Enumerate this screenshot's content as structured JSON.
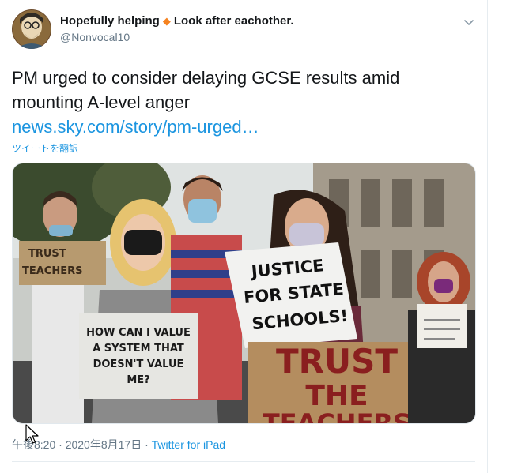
{
  "author": {
    "display_name": "Hopefully helping",
    "badge": "◆",
    "display_name_suffix": "Look after eachother.",
    "handle": "@Nonvocal10",
    "avatar_icon": "illustrated-portrait-avatar"
  },
  "tweet": {
    "text": "PM urged to consider delaying GCSE results amid mounting A-level anger",
    "link_text": "news.sky.com/story/pm-urged…",
    "translate_label": "ツイートを翻訳"
  },
  "media": {
    "signs": {
      "trust_teachers_small": [
        "TRUST",
        "TEACHERS"
      ],
      "how_can_i": [
        "HOW CAN I VALUE",
        "A SYSTEM THAT",
        "DOESN'T VALUE",
        "ME?"
      ],
      "justice": [
        "JUSTICE",
        "FOR STATE",
        "SCHOOLS!"
      ],
      "trust_the_teachers": [
        "TRUST",
        "THE",
        "TEACHERS"
      ]
    }
  },
  "meta": {
    "timestamp": "午後8:20 · 2020年8月17日",
    "separator": " · ",
    "source": "Twitter for iPad"
  },
  "colors": {
    "link": "#1b95e0",
    "secondary_text": "#657786",
    "badge": "#f5821f"
  }
}
